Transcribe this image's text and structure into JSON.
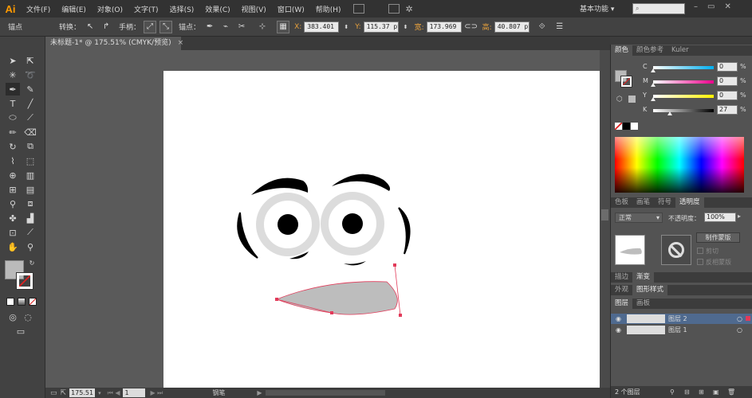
{
  "app": {
    "logo": "Ai",
    "workspace": "基本功能",
    "workspace_arrow": "▾"
  },
  "menu": [
    "文件(F)",
    "编辑(E)",
    "对象(O)",
    "文字(T)",
    "选择(S)",
    "效果(C)",
    "视图(V)",
    "窗口(W)",
    "帮助(H)"
  ],
  "control": {
    "mode_label": "锚点",
    "convert_label": "转换：",
    "handles_label": "手柄：",
    "anchor_label": "锚点：",
    "x_label": "X:",
    "x_value": "383.401 p",
    "y_label": "Y:",
    "y_value": "115.37 pt",
    "w_label": "宽:",
    "w_value": "173.969 p",
    "h_label": "高:",
    "h_value": "40.807 pt"
  },
  "document": {
    "tab_title": "未标题-1* @ 175.51% (CMYK/预览)",
    "close": "×"
  },
  "status": {
    "zoom": "175.51",
    "page": "1",
    "tool_name": "钢笔"
  },
  "color_panel": {
    "tabs": [
      "颜色",
      "颜色参考",
      "Kuler"
    ],
    "channels": [
      {
        "label": "C",
        "value": "0",
        "unit": "%",
        "level": 0,
        "gradient": "linear-gradient(to right,#ffffff,#00aeef)"
      },
      {
        "label": "M",
        "value": "0",
        "unit": "%",
        "level": 0,
        "gradient": "linear-gradient(to right,#ffffff,#ec008c)"
      },
      {
        "label": "Y",
        "value": "0",
        "unit": "%",
        "level": 0,
        "gradient": "linear-gradient(to right,#ffffff,#fff200)"
      },
      {
        "label": "K",
        "value": "27",
        "unit": "%",
        "level": 0.27,
        "gradient": "linear-gradient(to right,#ffffff,#000000)"
      }
    ]
  },
  "mid_tabs": [
    "色板",
    "画笔",
    "符号",
    "透明度"
  ],
  "transparency": {
    "blend_mode": "正常",
    "opacity_label": "不透明度：",
    "opacity_value": "100%",
    "make_mask": "制作蒙版",
    "clip": "剪切",
    "invert": "反相蒙版"
  },
  "stroke_tabs": [
    "描边",
    "渐变"
  ],
  "appearance_tabs": [
    "外观",
    "图形样式"
  ],
  "layers_tabs": [
    "图层",
    "画板"
  ],
  "layers": [
    {
      "name": "图层 2"
    },
    {
      "name": "图层 1"
    }
  ],
  "layers_footer": {
    "count": "2 个图层"
  },
  "colors": {
    "accent": "#ff9a00",
    "fill_swatch": "#bababa",
    "path_selection": "#e23b5a"
  }
}
